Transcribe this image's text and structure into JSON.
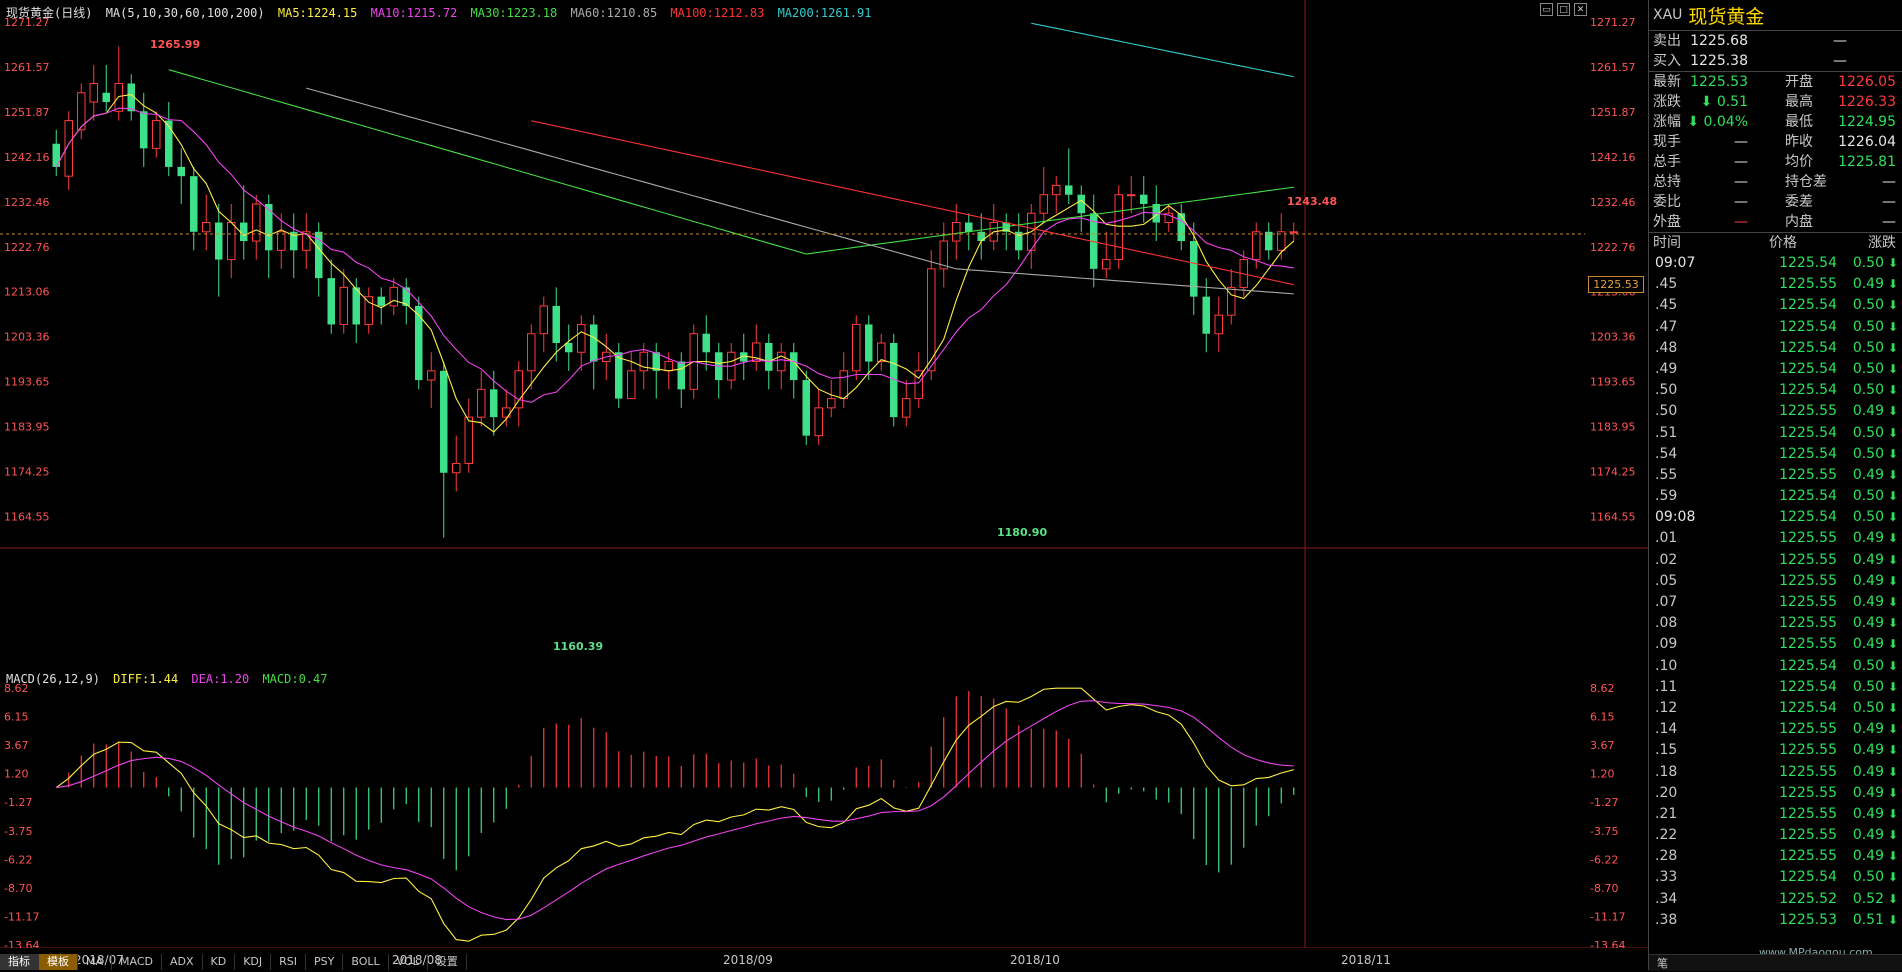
{
  "chart": {
    "title": "现货黄金(日线)",
    "ma_legend": {
      "params": "MA(5,10,30,60,100,200)",
      "ma5": "MA5:1224.15",
      "ma10": "MA10:1215.72",
      "ma30": "MA30:1223.18",
      "ma60": "MA60:1210.85",
      "ma100": "MA100:1212.83",
      "ma200": "MA200:1261.91"
    },
    "colors": {
      "up": "#ff3b3b",
      "down": "#3ee08a",
      "ma5": "#ffee44",
      "ma10": "#ee44ee",
      "ma30": "#44dd44",
      "ma60": "#aaaaaa",
      "ma100": "#ff3333",
      "ma200": "#33cccc"
    },
    "price_axis": [
      "1271.27",
      "1261.57",
      "1251.87",
      "1242.16",
      "1232.46",
      "1222.76",
      "1213.06",
      "1203.36",
      "1193.65",
      "1183.95",
      "1174.25",
      "1164.55"
    ],
    "last_price_tag": "1225.53",
    "annotations": {
      "high": "1265.99",
      "low": "1160.39",
      "mid_low": "1180.90",
      "mid_high": "1243.48"
    },
    "x_labels": [
      "2018/07",
      "2018/08",
      "2018/09",
      "2018/10",
      "2018/11"
    ],
    "period_label": "日线",
    "macd_legend": {
      "params": "MACD(26,12,9)",
      "diff": "DIFF:1.44",
      "dea": "DEA:1.20",
      "macd": "MACD:0.47"
    },
    "macd_axis": [
      "8.62",
      "6.15",
      "3.67",
      "1.20",
      "-1.27",
      "-3.75",
      "-6.22",
      "-8.70",
      "-11.17",
      "-13.64"
    ],
    "tabs": [
      "指标",
      "模板",
      "MA",
      "MACD",
      "ADX",
      "KD",
      "KDJ",
      "RSI",
      "PSY",
      "BOLL",
      "VOL",
      "设置"
    ]
  },
  "quote": {
    "code": "XAU",
    "name": "现货黄金",
    "sell": {
      "label": "卖出",
      "value": "1225.68",
      "vol": "—"
    },
    "buy": {
      "label": "买入",
      "value": "1225.38",
      "vol": "—"
    },
    "rows": [
      {
        "l1": "最新",
        "v1": "1225.53",
        "c1": "g",
        "l2": "开盘",
        "v2": "1226.05",
        "c2": "r"
      },
      {
        "l1": "涨跌",
        "v1": "⬇ 0.51",
        "c1": "g",
        "l2": "最高",
        "v2": "1226.33",
        "c2": "r"
      },
      {
        "l1": "涨幅",
        "v1": "⬇ 0.04%",
        "c1": "g",
        "l2": "最低",
        "v2": "1224.95",
        "c2": "g"
      },
      {
        "l1": "现手",
        "v1": "—",
        "c1": "w",
        "l2": "昨收",
        "v2": "1226.04",
        "c2": "w"
      },
      {
        "l1": "总手",
        "v1": "—",
        "c1": "w",
        "l2": "均价",
        "v2": "1225.81",
        "c2": "g"
      },
      {
        "l1": "总持",
        "v1": "—",
        "c1": "w",
        "l2": "持仓差",
        "v2": "—",
        "c2": "w"
      },
      {
        "l1": "委比",
        "v1": "—",
        "c1": "w",
        "l2": "委差",
        "v2": "—",
        "c2": "w"
      },
      {
        "l1": "外盘",
        "v1": "—",
        "c1": "r",
        "l2": "内盘",
        "v2": "—",
        "c2": "w"
      }
    ],
    "tick_header": {
      "time": "时间",
      "price": "价格",
      "change": "涨跌"
    },
    "ticks": [
      {
        "t": "09:07",
        "p": "1225.54",
        "c": "0.50"
      },
      {
        "t": ".45",
        "p": "1225.55",
        "c": "0.49"
      },
      {
        "t": ".45",
        "p": "1225.54",
        "c": "0.50"
      },
      {
        "t": ".47",
        "p": "1225.54",
        "c": "0.50"
      },
      {
        "t": ".48",
        "p": "1225.54",
        "c": "0.50"
      },
      {
        "t": ".49",
        "p": "1225.54",
        "c": "0.50"
      },
      {
        "t": ".50",
        "p": "1225.54",
        "c": "0.50"
      },
      {
        "t": ".50",
        "p": "1225.55",
        "c": "0.49"
      },
      {
        "t": ".51",
        "p": "1225.54",
        "c": "0.50"
      },
      {
        "t": ".54",
        "p": "1225.54",
        "c": "0.50"
      },
      {
        "t": ".55",
        "p": "1225.55",
        "c": "0.49"
      },
      {
        "t": ".59",
        "p": "1225.54",
        "c": "0.50"
      },
      {
        "t": "09:08",
        "p": "1225.54",
        "c": "0.50"
      },
      {
        "t": ".01",
        "p": "1225.55",
        "c": "0.49"
      },
      {
        "t": ".02",
        "p": "1225.55",
        "c": "0.49"
      },
      {
        "t": ".05",
        "p": "1225.55",
        "c": "0.49"
      },
      {
        "t": ".07",
        "p": "1225.55",
        "c": "0.49"
      },
      {
        "t": ".08",
        "p": "1225.55",
        "c": "0.49"
      },
      {
        "t": ".09",
        "p": "1225.55",
        "c": "0.49"
      },
      {
        "t": ".10",
        "p": "1225.54",
        "c": "0.50"
      },
      {
        "t": ".11",
        "p": "1225.54",
        "c": "0.50"
      },
      {
        "t": ".12",
        "p": "1225.54",
        "c": "0.50"
      },
      {
        "t": ".14",
        "p": "1225.55",
        "c": "0.49"
      },
      {
        "t": ".15",
        "p": "1225.55",
        "c": "0.49"
      },
      {
        "t": ".18",
        "p": "1225.55",
        "c": "0.49"
      },
      {
        "t": ".20",
        "p": "1225.55",
        "c": "0.49"
      },
      {
        "t": ".21",
        "p": "1225.55",
        "c": "0.49"
      },
      {
        "t": ".22",
        "p": "1225.55",
        "c": "0.49"
      },
      {
        "t": ".28",
        "p": "1225.55",
        "c": "0.49"
      },
      {
        "t": ".33",
        "p": "1225.54",
        "c": "0.50"
      },
      {
        "t": ".34",
        "p": "1225.52",
        "c": "0.52"
      },
      {
        "t": ".38",
        "p": "1225.53",
        "c": "0.51"
      }
    ],
    "watermark": "www.MPdaogou.com",
    "footer_tab": "笔"
  },
  "chart_data": {
    "type": "candlestick",
    "candles": [
      [
        1245,
        1240,
        1248,
        1238
      ],
      [
        1238,
        1250,
        1252,
        1235
      ],
      [
        1248,
        1256,
        1258,
        1246
      ],
      [
        1254,
        1258,
        1262,
        1250
      ],
      [
        1256,
        1254,
        1262,
        1252
      ],
      [
        1252,
        1258,
        1266,
        1250
      ],
      [
        1258,
        1252,
        1260,
        1250
      ],
      [
        1252,
        1244,
        1256,
        1240
      ],
      [
        1244,
        1250,
        1252,
        1242
      ],
      [
        1250,
        1240,
        1254,
        1238
      ],
      [
        1240,
        1238,
        1244,
        1232
      ],
      [
        1238,
        1226,
        1240,
        1222
      ],
      [
        1226,
        1228,
        1234,
        1222
      ],
      [
        1228,
        1220,
        1232,
        1212
      ],
      [
        1220,
        1228,
        1232,
        1216
      ],
      [
        1228,
        1224,
        1236,
        1220
      ],
      [
        1224,
        1232,
        1234,
        1220
      ],
      [
        1232,
        1222,
        1234,
        1216
      ],
      [
        1222,
        1226,
        1230,
        1218
      ],
      [
        1226,
        1222,
        1230,
        1216
      ],
      [
        1222,
        1226,
        1230,
        1218
      ],
      [
        1226,
        1216,
        1228,
        1212
      ],
      [
        1216,
        1206,
        1220,
        1204
      ],
      [
        1206,
        1214,
        1218,
        1204
      ],
      [
        1214,
        1206,
        1216,
        1202
      ],
      [
        1206,
        1212,
        1214,
        1204
      ],
      [
        1212,
        1210,
        1214,
        1206
      ],
      [
        1210,
        1214,
        1216,
        1208
      ],
      [
        1214,
        1210,
        1216,
        1206
      ],
      [
        1210,
        1194,
        1212,
        1192
      ],
      [
        1194,
        1196,
        1200,
        1188
      ],
      [
        1196,
        1174,
        1198,
        1160
      ],
      [
        1174,
        1176,
        1182,
        1170
      ],
      [
        1176,
        1186,
        1190,
        1174
      ],
      [
        1186,
        1192,
        1196,
        1184
      ],
      [
        1192,
        1186,
        1196,
        1182
      ],
      [
        1186,
        1188,
        1192,
        1184
      ],
      [
        1188,
        1196,
        1198,
        1184
      ],
      [
        1196,
        1204,
        1206,
        1192
      ],
      [
        1204,
        1210,
        1212,
        1200
      ],
      [
        1210,
        1202,
        1214,
        1198
      ],
      [
        1202,
        1200,
        1206,
        1196
      ],
      [
        1200,
        1206,
        1208,
        1196
      ],
      [
        1206,
        1198,
        1208,
        1192
      ],
      [
        1198,
        1200,
        1204,
        1194
      ],
      [
        1200,
        1190,
        1202,
        1188
      ],
      [
        1190,
        1196,
        1200,
        1190
      ],
      [
        1196,
        1200,
        1202,
        1192
      ],
      [
        1200,
        1196,
        1202,
        1190
      ],
      [
        1196,
        1198,
        1200,
        1192
      ],
      [
        1198,
        1192,
        1200,
        1188
      ],
      [
        1192,
        1204,
        1206,
        1190
      ],
      [
        1204,
        1200,
        1208,
        1196
      ],
      [
        1200,
        1194,
        1202,
        1190
      ],
      [
        1194,
        1200,
        1202,
        1192
      ],
      [
        1200,
        1198,
        1204,
        1194
      ],
      [
        1198,
        1202,
        1206,
        1196
      ],
      [
        1202,
        1196,
        1204,
        1192
      ],
      [
        1196,
        1200,
        1202,
        1192
      ],
      [
        1200,
        1194,
        1202,
        1190
      ],
      [
        1194,
        1182,
        1196,
        1180
      ],
      [
        1182,
        1188,
        1192,
        1180
      ],
      [
        1188,
        1190,
        1194,
        1186
      ],
      [
        1190,
        1196,
        1200,
        1188
      ],
      [
        1196,
        1206,
        1208,
        1194
      ],
      [
        1206,
        1198,
        1208,
        1194
      ],
      [
        1198,
        1202,
        1204,
        1196
      ],
      [
        1202,
        1186,
        1204,
        1184
      ],
      [
        1186,
        1190,
        1194,
        1184
      ],
      [
        1190,
        1196,
        1200,
        1188
      ],
      [
        1196,
        1218,
        1222,
        1194
      ],
      [
        1218,
        1224,
        1228,
        1214
      ],
      [
        1224,
        1228,
        1232,
        1220
      ],
      [
        1228,
        1226,
        1230,
        1222
      ],
      [
        1226,
        1224,
        1230,
        1220
      ],
      [
        1224,
        1228,
        1232,
        1222
      ],
      [
        1228,
        1226,
        1230,
        1222
      ],
      [
        1226,
        1222,
        1230,
        1220
      ],
      [
        1222,
        1230,
        1232,
        1218
      ],
      [
        1230,
        1234,
        1240,
        1228
      ],
      [
        1234,
        1236,
        1238,
        1230
      ],
      [
        1236,
        1234,
        1244,
        1232
      ],
      [
        1234,
        1230,
        1236,
        1226
      ],
      [
        1230,
        1218,
        1234,
        1214
      ],
      [
        1218,
        1220,
        1226,
        1216
      ],
      [
        1220,
        1234,
        1236,
        1218
      ],
      [
        1234,
        1234,
        1238,
        1230
      ],
      [
        1234,
        1232,
        1238,
        1228
      ],
      [
        1232,
        1228,
        1236,
        1224
      ],
      [
        1228,
        1230,
        1232,
        1226
      ],
      [
        1230,
        1224,
        1232,
        1222
      ],
      [
        1224,
        1212,
        1228,
        1208
      ],
      [
        1212,
        1204,
        1216,
        1200
      ],
      [
        1204,
        1208,
        1212,
        1200
      ],
      [
        1208,
        1214,
        1218,
        1206
      ],
      [
        1214,
        1220,
        1222,
        1212
      ],
      [
        1220,
        1226,
        1228,
        1218
      ],
      [
        1226,
        1222,
        1228,
        1220
      ],
      [
        1222,
        1226,
        1230,
        1220
      ],
      [
        1226,
        1226,
        1228,
        1224
      ]
    ]
  }
}
